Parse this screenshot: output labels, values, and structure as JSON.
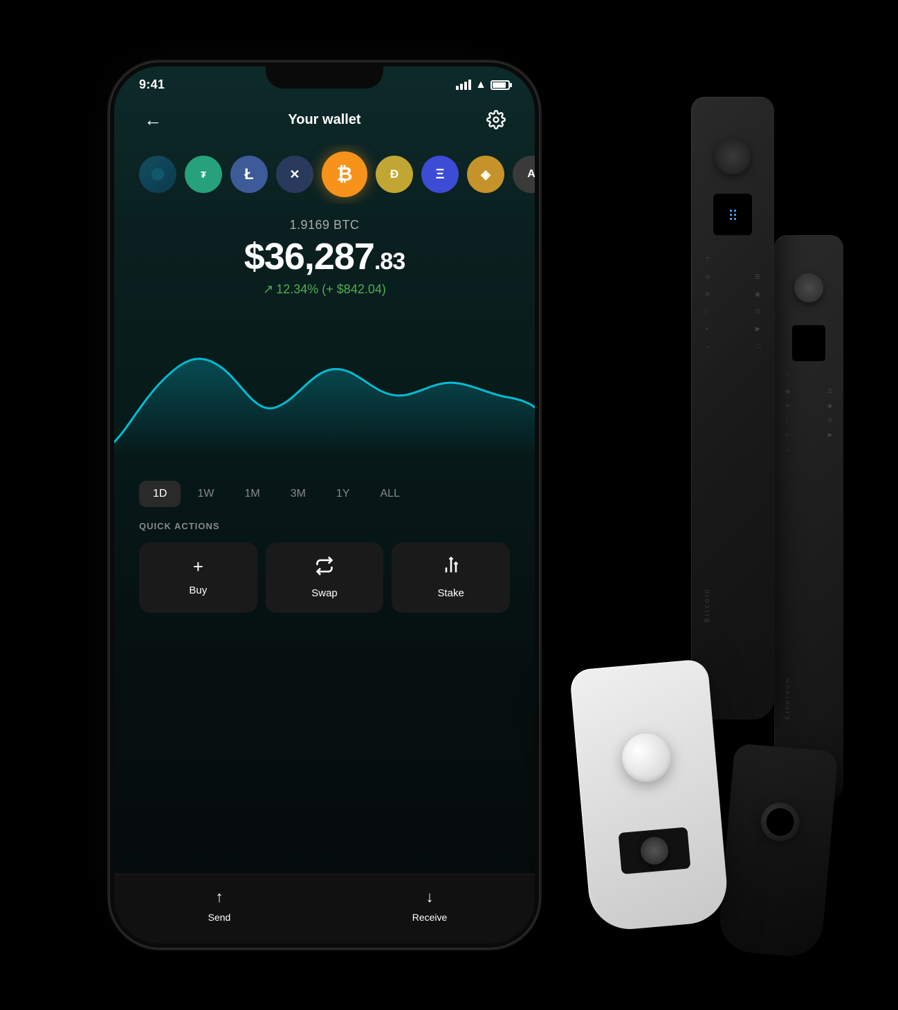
{
  "status": {
    "time": "9:41",
    "battery_level": "85"
  },
  "header": {
    "back_label": "←",
    "title": "Your wallet",
    "settings_label": "⚙"
  },
  "coins": [
    {
      "id": "partial",
      "symbol": "◐",
      "class": "coin-partial"
    },
    {
      "id": "tether",
      "symbol": "₮",
      "class": "coin-tether"
    },
    {
      "id": "litecoin",
      "symbol": "Ł",
      "class": "coin-litecoin"
    },
    {
      "id": "ripple",
      "symbol": "✕",
      "class": "coin-ripple"
    },
    {
      "id": "bitcoin",
      "symbol": "₿",
      "class": "coin-bitcoin",
      "active": true
    },
    {
      "id": "dogecoin",
      "symbol": "Ð",
      "class": "coin-doge"
    },
    {
      "id": "ethereum",
      "symbol": "Ξ",
      "class": "coin-eth"
    },
    {
      "id": "bnb",
      "symbol": "◈",
      "class": "coin-bnb"
    },
    {
      "id": "algorand",
      "symbol": "A",
      "class": "coin-algo"
    }
  ],
  "balance": {
    "btc_amount": "1.9169 BTC",
    "usd_main": "$36,287",
    "usd_cents": ".83",
    "change_arrow": "↗",
    "change_text": "12.34% (+ $842.04)"
  },
  "chart": {
    "time_periods": [
      {
        "label": "1D",
        "active": true
      },
      {
        "label": "1W",
        "active": false
      },
      {
        "label": "1M",
        "active": false
      },
      {
        "label": "3M",
        "active": false
      },
      {
        "label": "1Y",
        "active": false
      },
      {
        "label": "ALL",
        "active": false
      }
    ]
  },
  "quick_actions": {
    "label": "QUICK ACTIONS",
    "buttons": [
      {
        "id": "buy",
        "icon": "+",
        "label": "Buy"
      },
      {
        "id": "swap",
        "icon": "⇄",
        "label": "Swap"
      },
      {
        "id": "stake",
        "icon": "↑↑",
        "label": "Stake"
      }
    ]
  },
  "bottom_nav": [
    {
      "id": "send",
      "icon": "↑",
      "label": "Send"
    },
    {
      "id": "receive",
      "icon": "↓",
      "label": "Receive"
    }
  ],
  "hardware": {
    "wallet1_label": "Bitcoin",
    "wallet2_label": "Ethereum"
  }
}
